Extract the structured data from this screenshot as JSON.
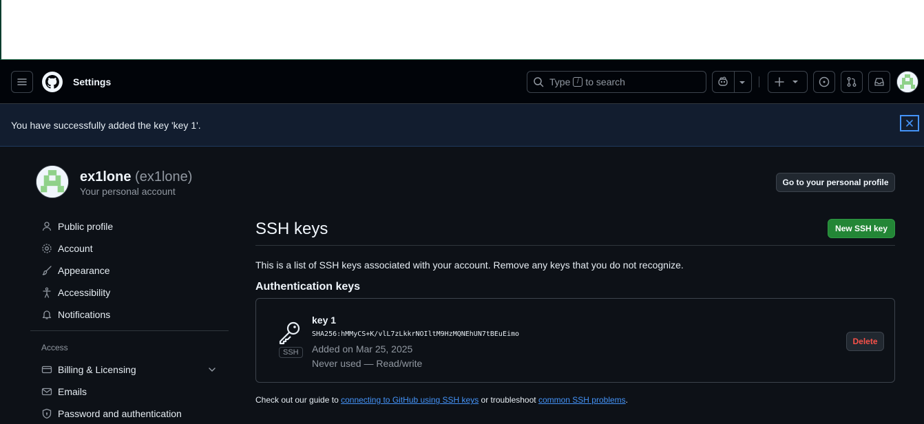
{
  "colors": {
    "page_bg": "#0d1117",
    "header_bg": "#010409",
    "flash_bg": "#121d2f",
    "accent_link": "#4493f8",
    "primary_button": "#238636",
    "danger_text": "#f85149",
    "muted_text": "#9198a1"
  },
  "header": {
    "title": "Settings",
    "search": {
      "prefix": "Type",
      "key": "/",
      "suffix": "to search"
    },
    "icons": [
      "menu-icon",
      "github-logo",
      "search-icon",
      "copilot-icon",
      "triangle-down-icon",
      "plus-icon",
      "issue-opened-icon",
      "git-pull-request-icon",
      "inbox-icon",
      "avatar"
    ]
  },
  "flash": {
    "message": "You have successfully added the key 'key 1'.",
    "close_icon": "x-icon"
  },
  "user": {
    "login": "ex1lone",
    "name_paren": "(ex1lone)",
    "subtitle": "Your personal account",
    "profile_button": "Go to your personal profile"
  },
  "sidebar": {
    "items": [
      {
        "label": "Public profile",
        "icon": "person-icon"
      },
      {
        "label": "Account",
        "icon": "gear-icon"
      },
      {
        "label": "Appearance",
        "icon": "paintbrush-icon"
      },
      {
        "label": "Accessibility",
        "icon": "accessibility-icon"
      },
      {
        "label": "Notifications",
        "icon": "bell-icon"
      }
    ],
    "group_access": "Access",
    "access_items": [
      {
        "label": "Billing & Licensing",
        "icon": "credit-card-icon",
        "expandable": true
      },
      {
        "label": "Emails",
        "icon": "mail-icon"
      },
      {
        "label": "Password and authentication",
        "icon": "shield-lock-icon"
      }
    ]
  },
  "main": {
    "title": "SSH keys",
    "new_button": "New SSH key",
    "description": "This is a list of SSH keys associated with your account. Remove any keys that you do not recognize.",
    "section_title": "Authentication keys",
    "keys": [
      {
        "title": "key 1",
        "fingerprint": "SHA256:hMMyCS+K/vlL7zLkkrNOIltM9HzMQNEhUN7tBEuEimo",
        "added": "Added on Mar 25, 2025",
        "usage": "Never used — Read/write",
        "badge": "SSH",
        "delete_label": "Delete"
      }
    ],
    "guide": {
      "prefix": "Check out our guide to",
      "link1": "connecting to GitHub using SSH keys",
      "middle": "or troubleshoot",
      "link2": "common SSH problems",
      "suffix": "."
    }
  }
}
